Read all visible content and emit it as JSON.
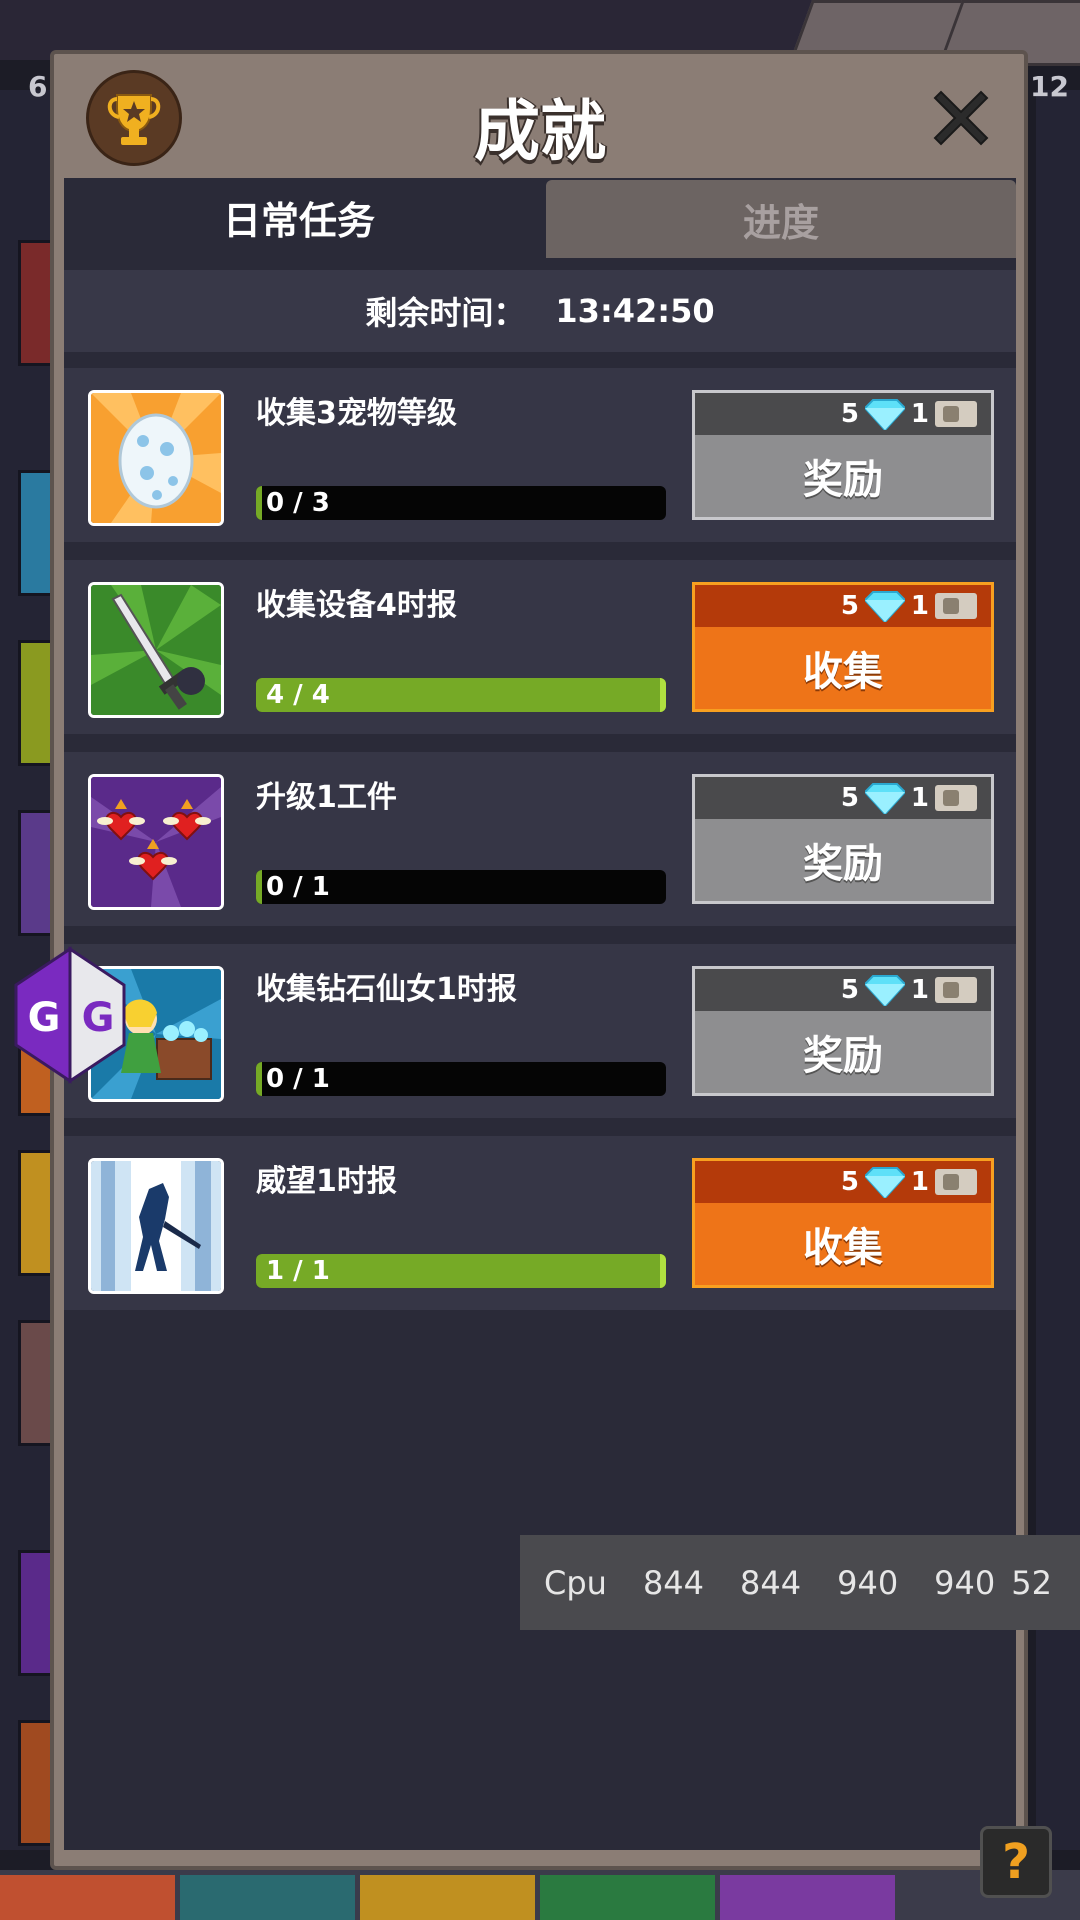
{
  "header": {
    "title": "成就"
  },
  "tabs": [
    {
      "label": "日常任务",
      "active": true
    },
    {
      "label": "进度",
      "active": false
    }
  ],
  "timer": {
    "label": "剩余时间：",
    "value": "13:42:50"
  },
  "background": {
    "left_number": "6.",
    "right_number": "12"
  },
  "tasks": [
    {
      "name": "收集3宠物等级",
      "progress_text": "0 / 3",
      "progress": 0.0,
      "gems": "5",
      "tickets": "1",
      "button": "奖励",
      "state": "locked",
      "icon": "egg-icon"
    },
    {
      "name": "收集设备4时报",
      "progress_text": "4 / 4",
      "progress": 1.0,
      "gems": "5",
      "tickets": "1",
      "button": "收集",
      "state": "collectable",
      "icon": "sword-icon"
    },
    {
      "name": "升级1工件",
      "progress_text": "0 / 1",
      "progress": 0.0,
      "gems": "5",
      "tickets": "1",
      "button": "奖励",
      "state": "locked",
      "icon": "winged-hearts-icon"
    },
    {
      "name": "收集钻石仙女1时报",
      "progress_text": "0 / 1",
      "progress": 0.0,
      "gems": "5",
      "tickets": "1",
      "button": "奖励",
      "state": "locked",
      "icon": "fairy-chest-icon"
    },
    {
      "name": "威望1时报",
      "progress_text": "1 / 1",
      "progress": 1.0,
      "gems": "5",
      "tickets": "1",
      "button": "收集",
      "state": "collectable",
      "icon": "hero-silhouette-icon"
    }
  ],
  "cpu_overlay": {
    "label": "Cpu",
    "values": [
      "844",
      "844",
      "940",
      "940",
      "52"
    ]
  },
  "gg_badge": {
    "letters": "GG"
  },
  "help": {
    "label": "?"
  },
  "colors": {
    "accent_orange": "#ee7418",
    "progress_green": "#76aa26",
    "panel": "#8b7d75",
    "inner": "#2a2a38"
  }
}
